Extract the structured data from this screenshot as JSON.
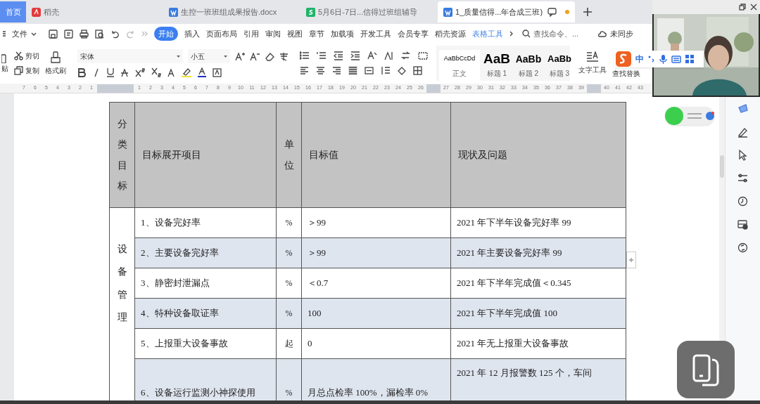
{
  "tabs": [
    {
      "kind": "home",
      "label": "首页",
      "selected": false
    },
    {
      "kind": "docer",
      "label": "稻壳",
      "selected": false
    },
    {
      "kind": "writer",
      "label": "生控一班班组成果报告.docx",
      "selected": false
    },
    {
      "kind": "sheet",
      "label": "5月6日-7日...信得过班组辅导",
      "selected": false
    },
    {
      "kind": "writer",
      "label": "1_质量信得...年合成三班)",
      "selected": true,
      "modified": true
    }
  ],
  "menu": {
    "file": "文件",
    "ribbon_tabs": [
      {
        "label": "开始",
        "selected": true,
        "kind": "normal"
      },
      {
        "label": "插入",
        "selected": false,
        "kind": "normal"
      },
      {
        "label": "页面布局",
        "selected": false,
        "kind": "normal"
      },
      {
        "label": "引用",
        "selected": false,
        "kind": "normal"
      },
      {
        "label": "审阅",
        "selected": false,
        "kind": "normal"
      },
      {
        "label": "视图",
        "selected": false,
        "kind": "normal"
      },
      {
        "label": "章节",
        "selected": false,
        "kind": "normal"
      },
      {
        "label": "加载项",
        "selected": false,
        "kind": "normal"
      },
      {
        "label": "开发工具",
        "selected": false,
        "kind": "normal"
      },
      {
        "label": "会员专享",
        "selected": false,
        "kind": "normal"
      },
      {
        "label": "稻壳资源",
        "selected": false,
        "kind": "normal"
      },
      {
        "label": "表格工具",
        "selected": false,
        "kind": "contextual"
      }
    ],
    "search": {
      "placeholder": "查找命令、..."
    },
    "sync": "未同步"
  },
  "toolbar": {
    "paste": "贴",
    "cut": "剪切",
    "copy": "复制",
    "format_painter": "格式刷",
    "font": "宋体",
    "size": "小五",
    "styles": [
      {
        "preview": "AaBbCcDd",
        "label": "正文",
        "kind": "body"
      },
      {
        "preview": "AaB",
        "label": "标题 1",
        "kind": "h1"
      },
      {
        "preview": "AaBb",
        "label": "标题 2",
        "kind": "h2"
      },
      {
        "preview": "AaBb",
        "label": "标题 3",
        "kind": "h3"
      }
    ],
    "text_tools": "文字工具",
    "find_replace": "查找替换"
  },
  "ruler": [
    "7",
    "6",
    "5",
    "4",
    "3",
    "2",
    "1",
    "1",
    "2",
    "3",
    "4",
    "5",
    "6",
    "7",
    "8",
    "9",
    "10",
    "11",
    "12",
    "13",
    "14",
    "15",
    "16",
    "17",
    "18",
    "19",
    "20",
    "21",
    "22",
    "23",
    "24",
    "25",
    "26",
    "27",
    "28",
    "29",
    "30",
    "31",
    "32",
    "33",
    "34",
    "35",
    "36",
    "37",
    "38",
    "39",
    "40",
    "41",
    "42",
    "43"
  ],
  "table": {
    "columns": [
      "分类目标",
      "目标展开项目",
      "单位",
      "目标值",
      "现状及问题"
    ],
    "category": "设备管理",
    "rows": [
      {
        "item": "1、设备完好率",
        "unit": "%",
        "target": "＞99",
        "status": "2021 年下半年设备完好率 99",
        "shaded": false
      },
      {
        "item": "2、主要设备完好率",
        "unit": "%",
        "target": "＞99",
        "status": "2021 年主要设备完好率 99",
        "shaded": true
      },
      {
        "item": "3、静密封泄漏点",
        "unit": "%",
        "target": "＜0.7",
        "status": "2021 年下半年完成值＜0.345",
        "shaded": false
      },
      {
        "item": "4、特种设备取证率",
        "unit": "%",
        "target": "100",
        "status": "2021 年下半年完成值 100",
        "shaded": true
      },
      {
        "item": "5、上报重大设备事故",
        "unit": "起",
        "target": "0",
        "status": "2021 年无上报重大设备事故",
        "shaded": false
      },
      {
        "item": "6、设备运行监测小神探使用",
        "unit": "%",
        "target": "月总点检率 100%，漏检率 0%",
        "status": "2021 年 12 月报警数 125 个，车间",
        "shaded": true
      }
    ]
  },
  "ime": {
    "mode": "中"
  }
}
